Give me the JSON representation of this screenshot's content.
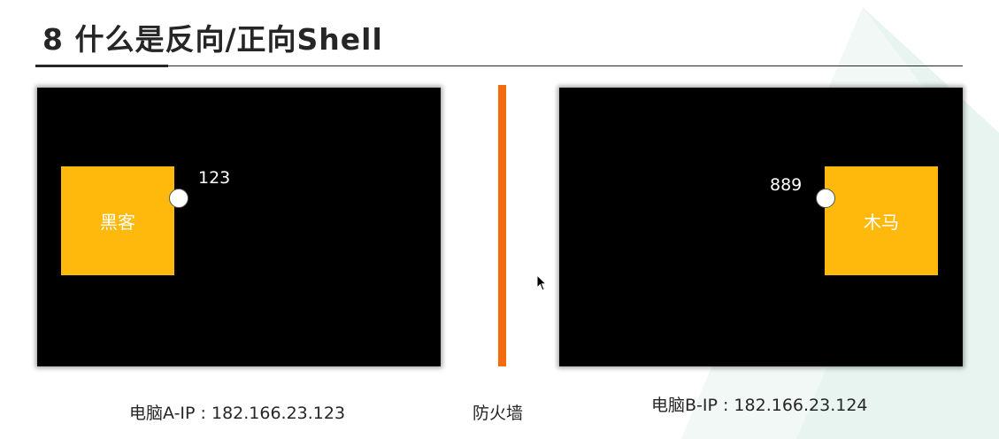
{
  "slide": {
    "title": "8 什么是反向/正向Shell"
  },
  "computer_a": {
    "box_label": "黑客",
    "port_label": "123",
    "caption": "电脑A-IP : 182.166.23.123"
  },
  "firewall": {
    "caption": "防火墙",
    "color": "#f26b0f"
  },
  "computer_b": {
    "box_label": "木马",
    "port_label": "889",
    "caption": "电脑B-IP : 182.166.23.124"
  },
  "colors": {
    "box": "#ffb80c",
    "screen": "#000000",
    "watermark": "#e6f3ee"
  },
  "icons": {
    "cursor": "mouse-pointer-icon"
  }
}
